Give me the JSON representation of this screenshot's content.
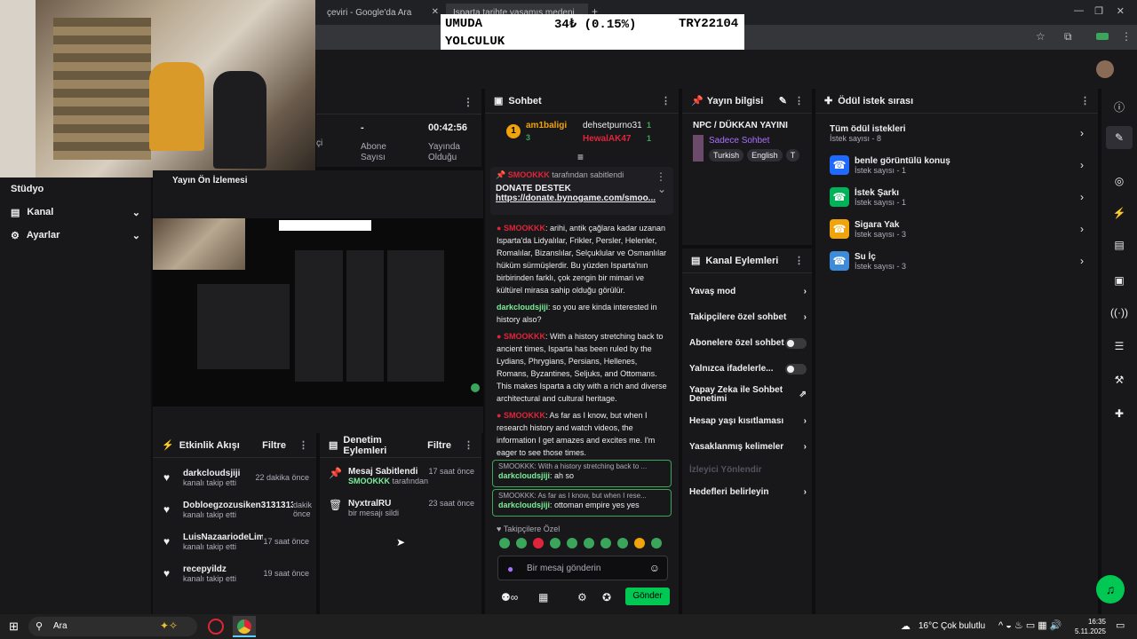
{
  "browser": {
    "tab1": "çeviri - Google'da Ara",
    "tab2": "Isparta tarihte yaşamış medeni..."
  },
  "ticker": {
    "label1": "UMUDA",
    "label2": "YOLCULUK",
    "amount": "34₺ (0.15%)",
    "target": "TRY22104"
  },
  "sidebar": {
    "items": [
      {
        "label": "Stüdyo"
      },
      {
        "label": "Kanal"
      },
      {
        "label": "Ayarlar"
      }
    ]
  },
  "stats": {
    "items": [
      {
        "value": "-",
        "label": "Abone Sayısı"
      },
      {
        "value": "00:42:56",
        "label": "Yayında Olduğu"
      }
    ],
    "left_cut": "çi"
  },
  "preview": {
    "title": "Yayın Ön İzlemesi"
  },
  "activity": {
    "title": "Etkinlik Akışı",
    "filter": "Filtre",
    "items": [
      {
        "name": "darkcloudsjiji",
        "action": "kanalı takip etti",
        "time": "22 dakika önce"
      },
      {
        "name": "Dobloegzozusiken31313131",
        "action": "kanalı takip etti",
        "time": "dakik önce"
      },
      {
        "name": "LuisNazaariodeLima",
        "action": "kanalı takip etti",
        "time": "17 saat önce"
      },
      {
        "name": "recepyildz",
        "action": "kanalı takip etti",
        "time": "19 saat önce"
      }
    ]
  },
  "moderation": {
    "title": "Denetim Eylemleri",
    "filter": "Filtre",
    "items": [
      {
        "title": "Mesaj Sabitlendi",
        "by": "SMOOKKK",
        "by_suffix": "tarafından",
        "time": "17 saat önce"
      },
      {
        "title": "NyxtralRU",
        "by": "bir mesajı sildi",
        "by_suffix": "",
        "time": "23 saat önce"
      }
    ]
  },
  "chat": {
    "title": "Sohbet",
    "leaders": {
      "first_name": "am1baligi",
      "first_count": "3",
      "second_name": "dehsetpurno31",
      "second_count": "1",
      "third_name": "HewalAK47",
      "third_count": "1"
    },
    "pinned": {
      "by": "SMOOKKK",
      "by_suffix": "tarafından sabitlendi",
      "title": "DONATE DESTEK",
      "link": "https://donate.bynogame.com/smoo..."
    },
    "messages": [
      {
        "name": "SMOOKKK",
        "text": ": arihi, antik çağlara kadar uzanan Isparta'da Lidyalılar, Frikler, Persler, Helenler, Romalılar, Bizanslılar, Selçuklular ve Osmanlılar hüküm sürmüşlerdir. Bu yüzden Isparta'nın birbirinden farklı, çok zengin bir mimari ve kültürel mirasa sahip olduğu görülür."
      },
      {
        "name": "darkcloudsjiji",
        "text": ": so you are kinda interested in history also?"
      },
      {
        "name": "SMOOKKK",
        "text": ": With a history stretching back to ancient times, Isparta has been ruled by the Lydians, Phrygians, Persians, Hellenes, Romans, Byzantines, Seljuks, and Ottomans. This makes Isparta a city with a rich and diverse architectural and cultural heritage."
      },
      {
        "name": "SMOOKKK",
        "text": ": As far as I know, but when I research history and watch videos, the information I get amazes and excites me. I'm eager to see those times."
      }
    ],
    "replies": [
      {
        "quote": "SMOOKKK: With a history stretching back to ...",
        "name": "darkcloudsjiji",
        "text": ": ah so"
      },
      {
        "quote": "SMOOKKK: As far as I know, but when I rese...",
        "name": "darkcloudsjiji",
        "text": ": ottoman empire yes yes"
      }
    ],
    "followers_only": "Takipçilere Özel",
    "placeholder": "Bir mesaj gönderin",
    "send": "Gönder"
  },
  "stream_info": {
    "title": "Yayın bilgisi",
    "stream_title": "NPC / DÜKKAN YAYINI",
    "category": "Sadece Sohbet",
    "tags": [
      "Turkish",
      "English",
      "T"
    ]
  },
  "channel_actions": {
    "title": "Kanal Eylemleri",
    "items": [
      {
        "label": "Yavaş mod",
        "type": "arrow"
      },
      {
        "label": "Takipçilere özel sohbet",
        "type": "arrow"
      },
      {
        "label": "Abonelere özel sohbet",
        "type": "toggle"
      },
      {
        "label": "Yalnızca ifadelerle...",
        "type": "toggle"
      },
      {
        "label": "Yapay Zeka ile Sohbet Denetimi",
        "type": "ext"
      },
      {
        "label": "Hesap yaşı kısıtlaması",
        "type": "arrow"
      },
      {
        "label": "Yasaklanmış kelimeler",
        "type": "arrow"
      },
      {
        "label": "İzleyici Yönlendir",
        "type": "disabled"
      },
      {
        "label": "Hedefleri belirleyin",
        "type": "arrow"
      }
    ]
  },
  "rewards": {
    "title": "Ödül istek sırası",
    "items": [
      {
        "name": "Tüm ödül istekleri",
        "count": "İstek sayısı - 8",
        "color": ""
      },
      {
        "name": "benle görüntülü konuş",
        "count": "İstek sayısı - 1",
        "color": "#1f69ff"
      },
      {
        "name": "İstek Şarkı",
        "count": "İstek sayısı - 1",
        "color": "#00b359"
      },
      {
        "name": "Sigara Yak",
        "count": "İstek sayısı - 3",
        "color": "#f0a30a"
      },
      {
        "name": "Su İç",
        "count": "İstek sayısı - 3",
        "color": "#3d8bd9"
      }
    ]
  },
  "taskbar": {
    "search": "Ara",
    "weather": "16°C Çok bulutlu",
    "time": "16:35",
    "date": "5.11.2025"
  }
}
